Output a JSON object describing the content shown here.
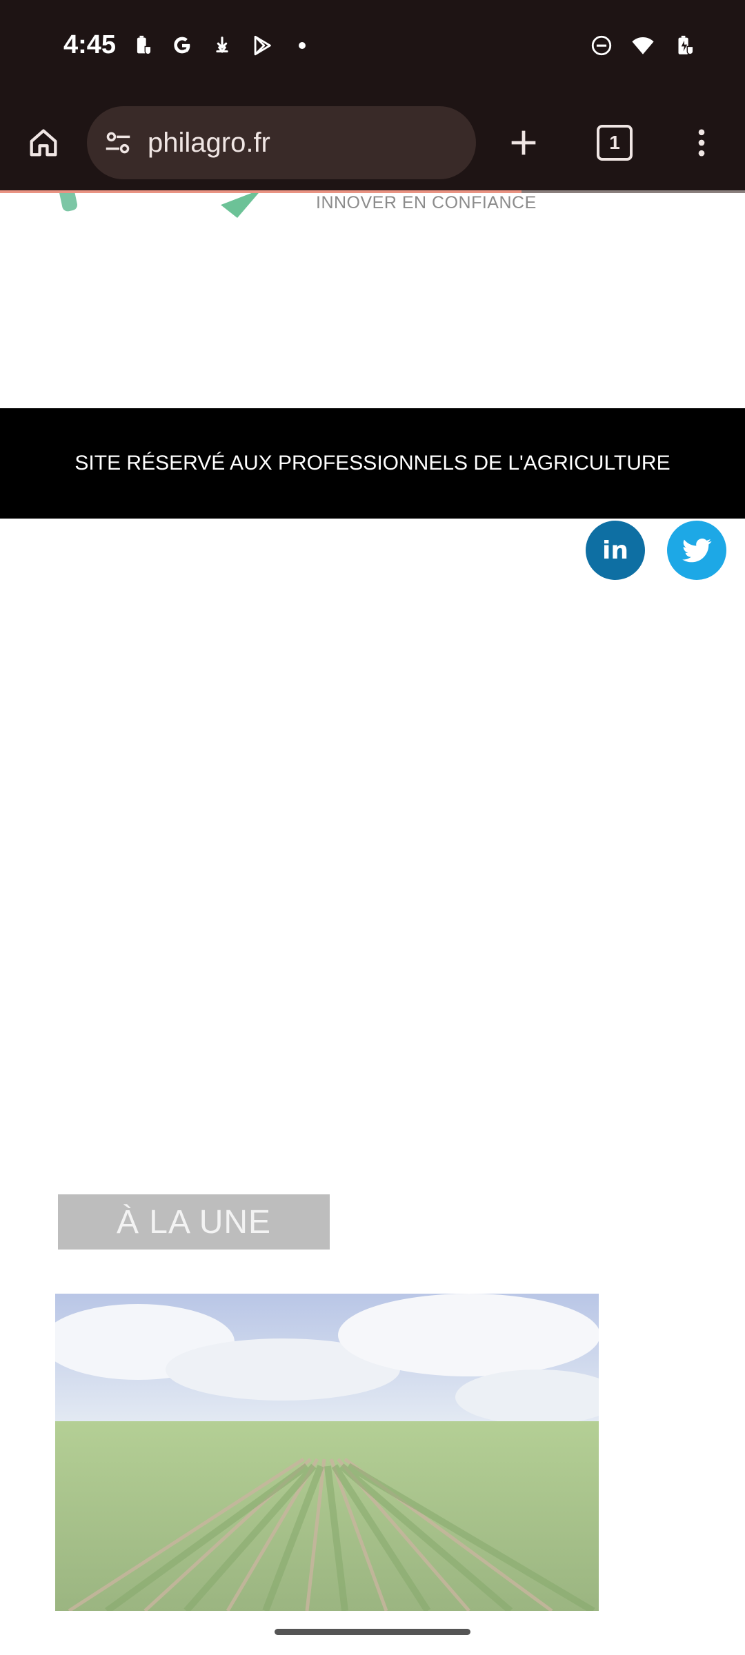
{
  "status_bar": {
    "time": "4:45",
    "left_icons": [
      "battery-saver-icon",
      "google-icon",
      "download-icon",
      "play-store-icon",
      "notification-dot-icon"
    ],
    "right_icons": [
      "do-not-disturb-icon",
      "wifi-icon",
      "battery-charging-icon"
    ]
  },
  "browser": {
    "url": "philagro.fr",
    "tab_count": "1",
    "load_progress": 0.7,
    "toolbar_color": "#1e1414",
    "urlbar_color": "#392a28"
  },
  "page": {
    "tagline": "INNOVER EN CONFIANCE",
    "banner_text": "SITE RÉSERVÉ AUX PROFESSIONNELS DE L'AGRICULTURE",
    "social": {
      "linkedin_label": "in",
      "linkedin_color": "#0e6fa3",
      "twitter_color": "#1da8e6"
    },
    "section_label": "À LA UNE",
    "featured_image": "vineyard-field-image"
  }
}
